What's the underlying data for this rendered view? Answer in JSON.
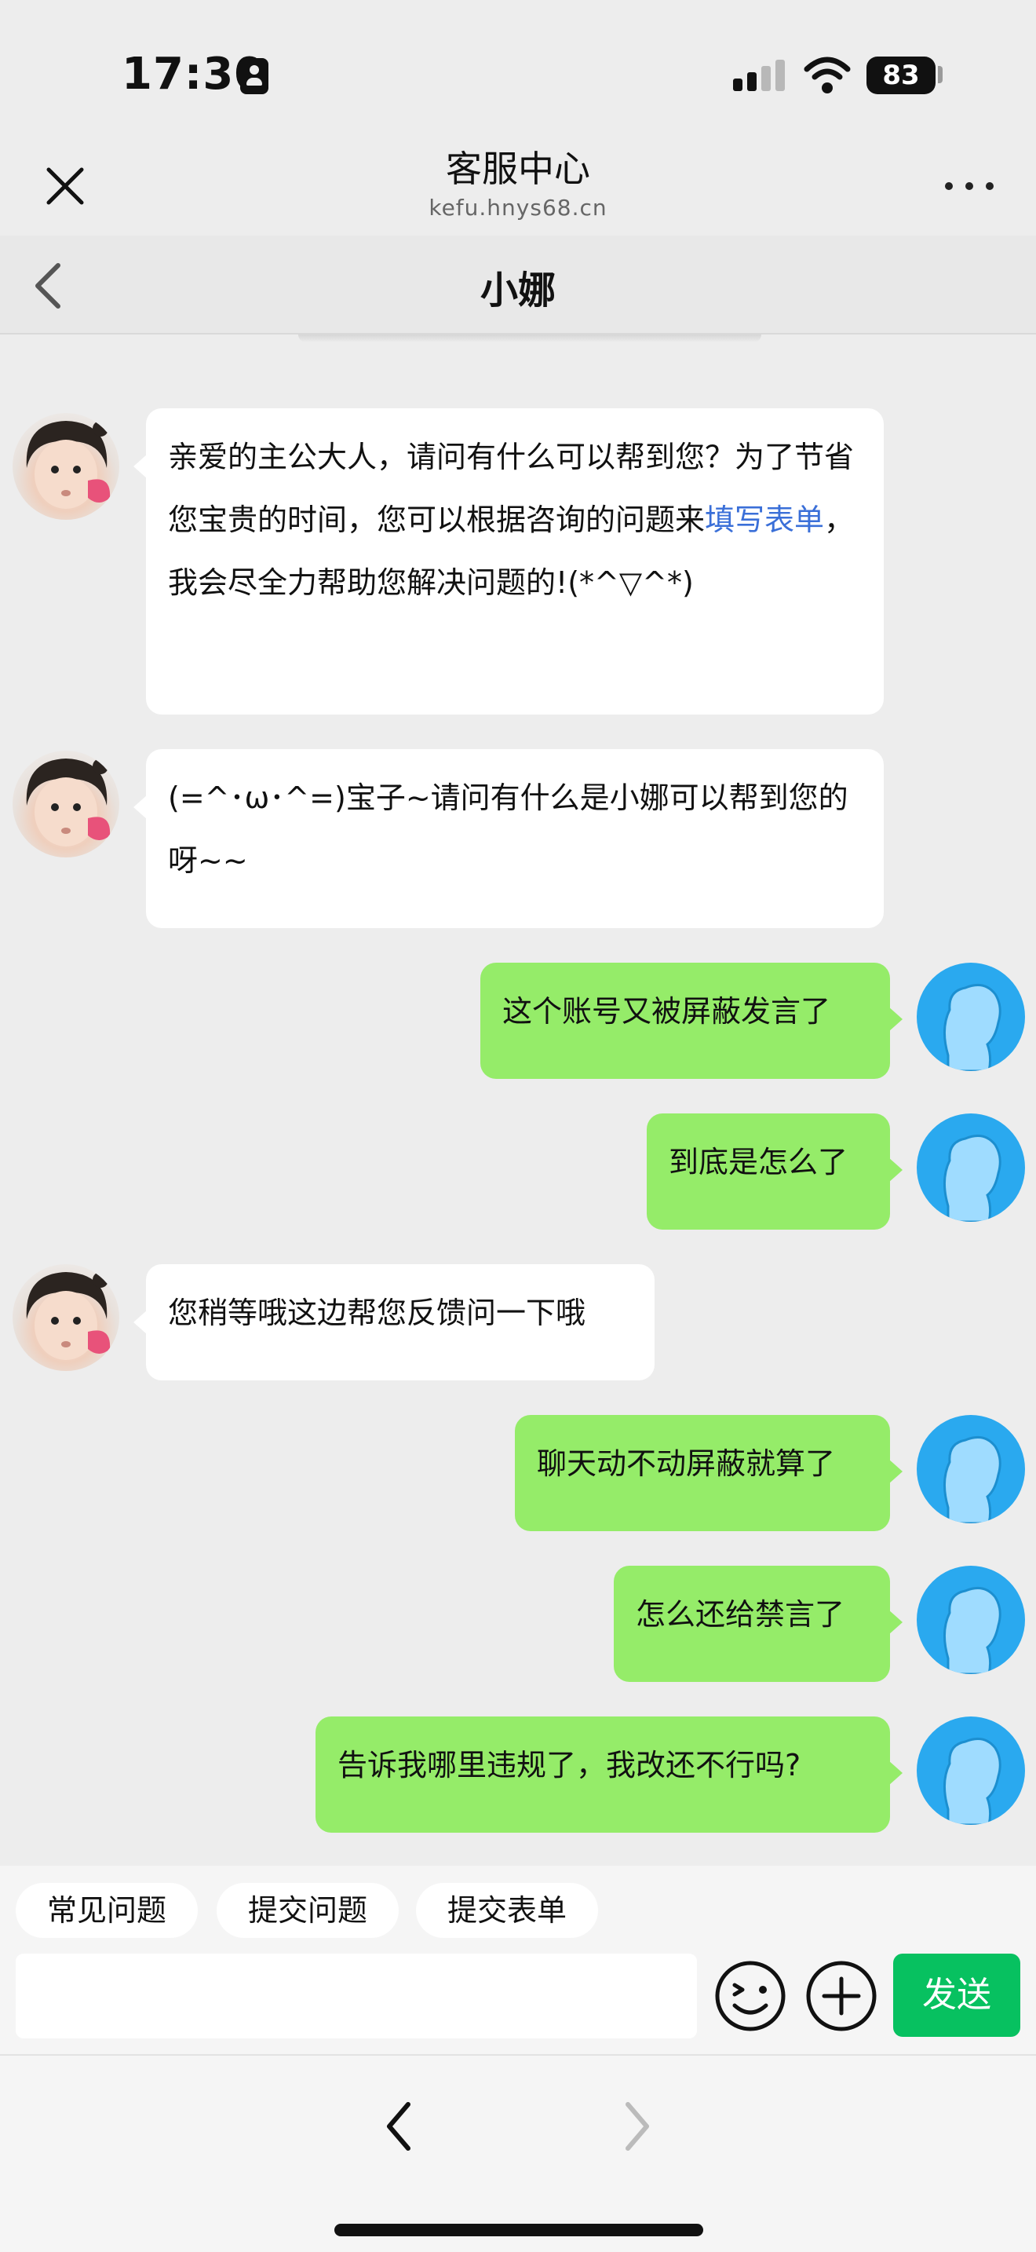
{
  "status": {
    "time": "17:30",
    "battery": "83"
  },
  "browser": {
    "title": "客服中心",
    "url": "kefu.hnys68.cn"
  },
  "chat": {
    "agent_name": "小娜"
  },
  "messages": [
    {
      "from": "agent",
      "text_before": "亲爱的主公大人，请问有什么可以帮到您？为了节省您宝贵的时间，您可以根据咨询的问题来",
      "link": "填写表单",
      "text_after": "，我会尽全力帮助您解决问题的!(*^▽^*)"
    },
    {
      "from": "agent",
      "text": "(=^･ω･^=)宝子~请问有什么是小娜可以帮到您的呀~~"
    },
    {
      "from": "user",
      "text": "这个账号又被屏蔽发言了"
    },
    {
      "from": "user",
      "text": "到底是怎么了"
    },
    {
      "from": "agent",
      "text": "您稍等哦这边帮您反馈问一下哦"
    },
    {
      "from": "user",
      "text": "聊天动不动屏蔽就算了"
    },
    {
      "from": "user",
      "text": "怎么还给禁言了"
    },
    {
      "from": "user",
      "text": "告诉我哪里违规了，我改还不行吗?"
    }
  ],
  "quick_actions": [
    "常见问题",
    "提交问题",
    "提交表单"
  ],
  "composer": {
    "value": "",
    "send_label": "发送"
  },
  "icons": {
    "close": "close-icon",
    "more": "more-icon",
    "back": "chevron-left-icon",
    "emoji": "emoji-icon",
    "add": "plus-circle-icon",
    "browser_back": "chevron-left-icon",
    "browser_forward": "chevron-right-icon"
  },
  "colors": {
    "user_bubble": "#95ec69",
    "agent_bubble": "#ffffff",
    "send_button": "#07c160",
    "link": "#3a6fd8",
    "user_avatar": "#2aa9ef"
  }
}
